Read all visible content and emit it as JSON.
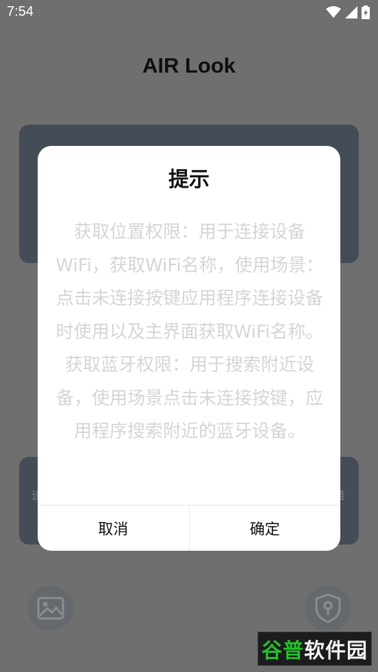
{
  "status_bar": {
    "time": "7:54",
    "icons": [
      "wifi-icon",
      "signal-icon",
      "battery-icon"
    ]
  },
  "app": {
    "title": "AIR Look",
    "bottom_card_left_text": "设",
    "bottom_card_right_text": "量"
  },
  "bottom_buttons": {
    "left_icon": "image-icon",
    "right_icon": "shield-icon"
  },
  "dialog": {
    "title": "提示",
    "paragraphs": [
      "获取位置权限：用于连接设备WiFi，获取WiFi名称，使用场景：点击未连接按键应用程序连接设备时使用以及主界面获取WiFi名称。",
      "获取蓝牙权限：用于搜索附近设备，使用场景点击未连接按键，应用程序搜索附近的蓝牙设备。"
    ],
    "cancel_label": "取消",
    "confirm_label": "确定"
  },
  "watermark": {
    "part1": "谷普",
    "part2": "软件园"
  },
  "colors": {
    "overlay_background": "#6f6f6f",
    "card": "#444c57",
    "dialog": "#ffffff",
    "dialog_body_text": "#d5d5d5",
    "watermark_green": "#22c32a"
  }
}
